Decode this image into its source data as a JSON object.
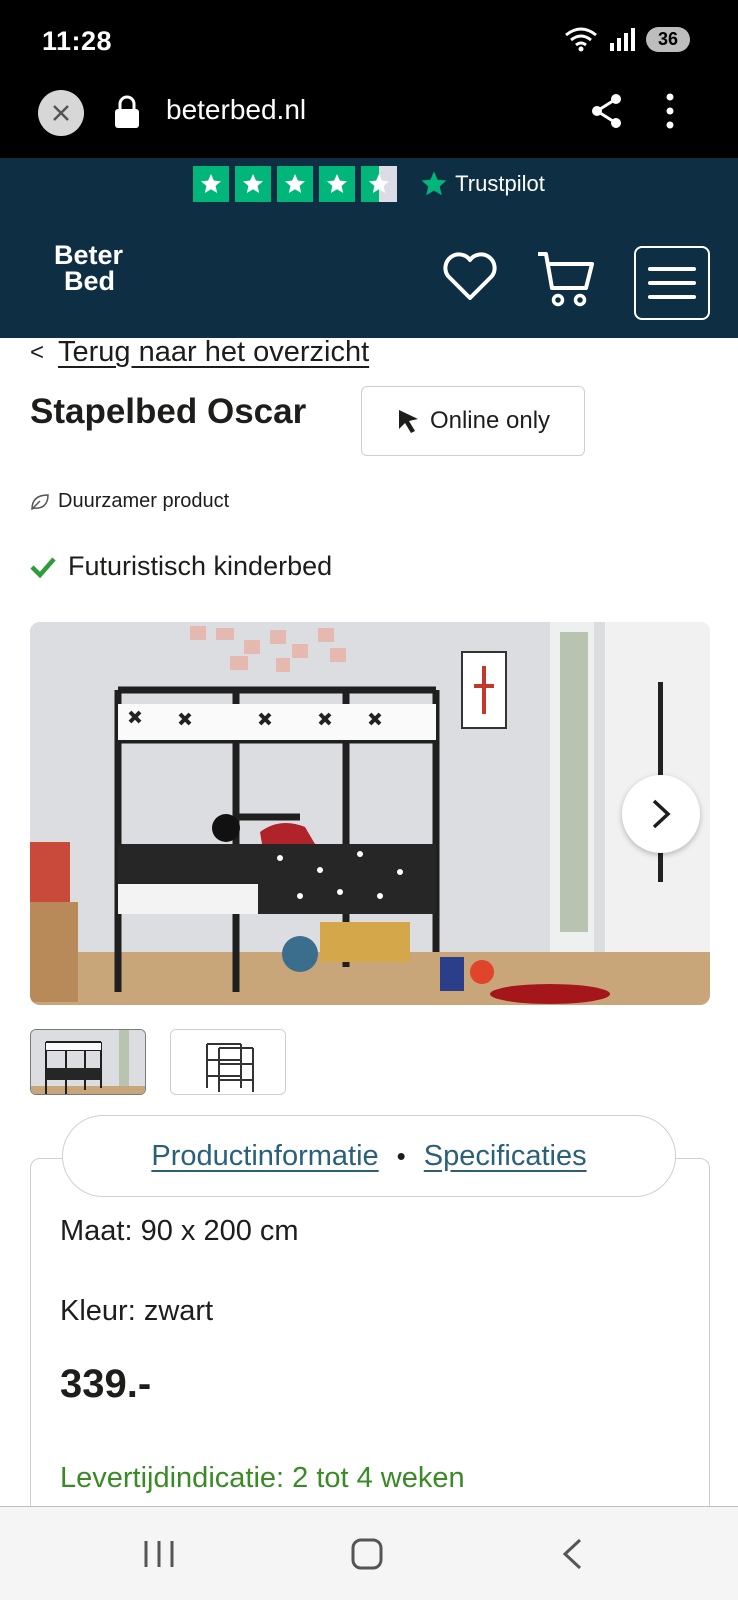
{
  "status": {
    "time": "11:28",
    "battery": "36"
  },
  "browser": {
    "url": "beterbed.nl"
  },
  "trustpilot": {
    "label": "Trustpilot",
    "rating": 4.5,
    "star_color": "#00b67a"
  },
  "header": {
    "logo_line1": "Beter",
    "logo_line2": "Bed",
    "brand_color": "#0e2e43",
    "logo_moon_color": "#f5c400"
  },
  "product": {
    "back_label": "Terug naar het overzicht",
    "title": "Stapelbed Oscar",
    "badge": "Online only",
    "sustainability": "Duurzamer product",
    "usp": "Futuristisch kinderbed"
  },
  "tabs": {
    "info": "Productinformatie",
    "separator": "•",
    "specs": "Specificaties"
  },
  "details": {
    "size": "Maat: 90 x 200 cm",
    "color": "Kleur: zwart",
    "price": "339.-",
    "delivery": "Levertijdindicatie: 2 tot 4 weken"
  },
  "colors": {
    "link": "#2a6079",
    "delivery_green": "#3a8a26",
    "check_green": "#2e9e3a"
  }
}
